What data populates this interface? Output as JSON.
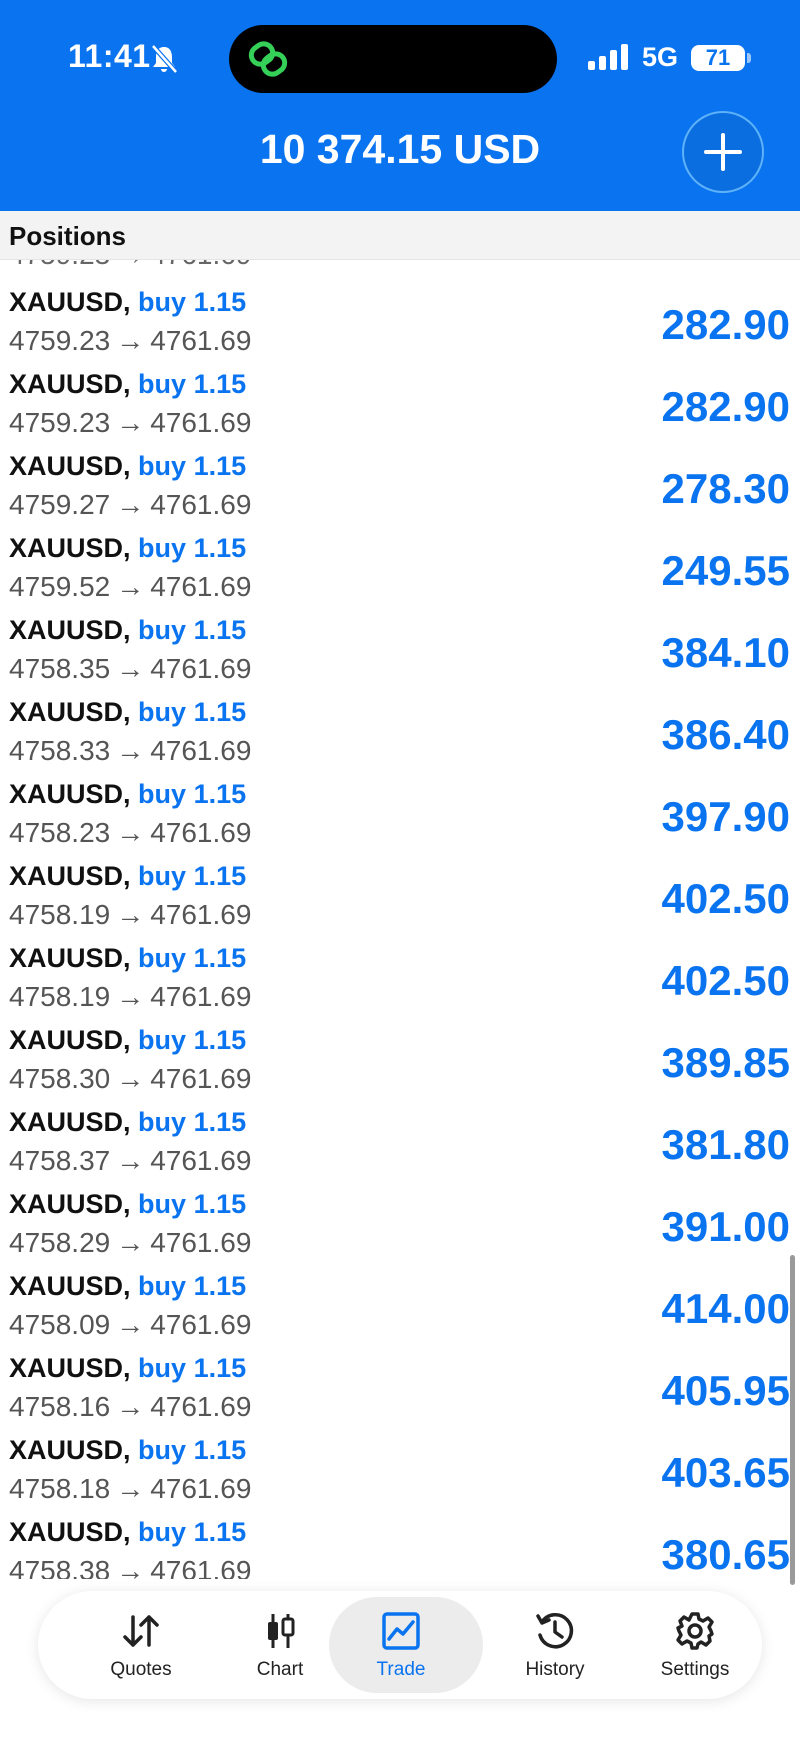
{
  "status_bar": {
    "time": "11:41",
    "network": "5G",
    "battery": "71"
  },
  "header": {
    "balance": "10 374.15 USD"
  },
  "section": {
    "title": "Positions"
  },
  "positions": [
    {
      "symbol": "XAUUSD,",
      "side": "buy",
      "volume": "1.15",
      "open": "4759.23",
      "arrow": "→",
      "current": "4761.69",
      "profit": "282.90"
    },
    {
      "symbol": "XAUUSD,",
      "side": "buy",
      "volume": "1.15",
      "open": "4759.23",
      "arrow": "→",
      "current": "4761.69",
      "profit": "282.90"
    },
    {
      "symbol": "XAUUSD,",
      "side": "buy",
      "volume": "1.15",
      "open": "4759.27",
      "arrow": "→",
      "current": "4761.69",
      "profit": "278.30"
    },
    {
      "symbol": "XAUUSD,",
      "side": "buy",
      "volume": "1.15",
      "open": "4759.52",
      "arrow": "→",
      "current": "4761.69",
      "profit": "249.55"
    },
    {
      "symbol": "XAUUSD,",
      "side": "buy",
      "volume": "1.15",
      "open": "4758.35",
      "arrow": "→",
      "current": "4761.69",
      "profit": "384.10"
    },
    {
      "symbol": "XAUUSD,",
      "side": "buy",
      "volume": "1.15",
      "open": "4758.33",
      "arrow": "→",
      "current": "4761.69",
      "profit": "386.40"
    },
    {
      "symbol": "XAUUSD,",
      "side": "buy",
      "volume": "1.15",
      "open": "4758.23",
      "arrow": "→",
      "current": "4761.69",
      "profit": "397.90"
    },
    {
      "symbol": "XAUUSD,",
      "side": "buy",
      "volume": "1.15",
      "open": "4758.19",
      "arrow": "→",
      "current": "4761.69",
      "profit": "402.50"
    },
    {
      "symbol": "XAUUSD,",
      "side": "buy",
      "volume": "1.15",
      "open": "4758.19",
      "arrow": "→",
      "current": "4761.69",
      "profit": "402.50"
    },
    {
      "symbol": "XAUUSD,",
      "side": "buy",
      "volume": "1.15",
      "open": "4758.30",
      "arrow": "→",
      "current": "4761.69",
      "profit": "389.85"
    },
    {
      "symbol": "XAUUSD,",
      "side": "buy",
      "volume": "1.15",
      "open": "4758.37",
      "arrow": "→",
      "current": "4761.69",
      "profit": "381.80"
    },
    {
      "symbol": "XAUUSD,",
      "side": "buy",
      "volume": "1.15",
      "open": "4758.29",
      "arrow": "→",
      "current": "4761.69",
      "profit": "391.00"
    },
    {
      "symbol": "XAUUSD,",
      "side": "buy",
      "volume": "1.15",
      "open": "4758.09",
      "arrow": "→",
      "current": "4761.69",
      "profit": "414.00"
    },
    {
      "symbol": "XAUUSD,",
      "side": "buy",
      "volume": "1.15",
      "open": "4758.16",
      "arrow": "→",
      "current": "4761.69",
      "profit": "405.95"
    },
    {
      "symbol": "XAUUSD,",
      "side": "buy",
      "volume": "1.15",
      "open": "4758.18",
      "arrow": "→",
      "current": "4761.69",
      "profit": "403.65"
    },
    {
      "symbol": "XAUUSD,",
      "side": "buy",
      "volume": "1.15",
      "open": "4758.38",
      "arrow": "→",
      "current": "4761.69",
      "profit": "380.65"
    }
  ],
  "tabs": [
    {
      "label": "Quotes",
      "icon": "quotes-arrows-icon"
    },
    {
      "label": "Chart",
      "icon": "candlestick-icon"
    },
    {
      "label": "Trade",
      "icon": "trade-chart-icon",
      "active": true
    },
    {
      "label": "History",
      "icon": "history-clock-icon"
    },
    {
      "label": "Settings",
      "icon": "gear-icon"
    }
  ],
  "colors": {
    "brand": "#0a74f0",
    "profit": "#0a74f0",
    "header_bg": "#0a74f0"
  }
}
